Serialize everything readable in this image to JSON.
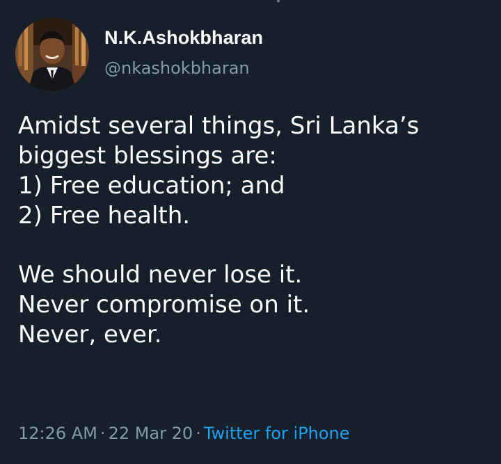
{
  "author": {
    "display_name": "N.K.Ashokbharan",
    "handle": "@nkashokbharan"
  },
  "tweet": {
    "lines": [
      "Amidst several things, Sri Lanka’s",
      "biggest blessings are:",
      "1) Free education; and",
      "2) Free health.",
      "We should never lose it.",
      "Never compromise on it.",
      "Never, ever."
    ]
  },
  "meta": {
    "time": "12:26 AM",
    "date": "22 Mar 20",
    "separator": "·",
    "source": "Twitter for iPhone"
  },
  "colors": {
    "background": "#15202b",
    "secondary_text": "#8899a6",
    "link": "#1da1f2"
  }
}
